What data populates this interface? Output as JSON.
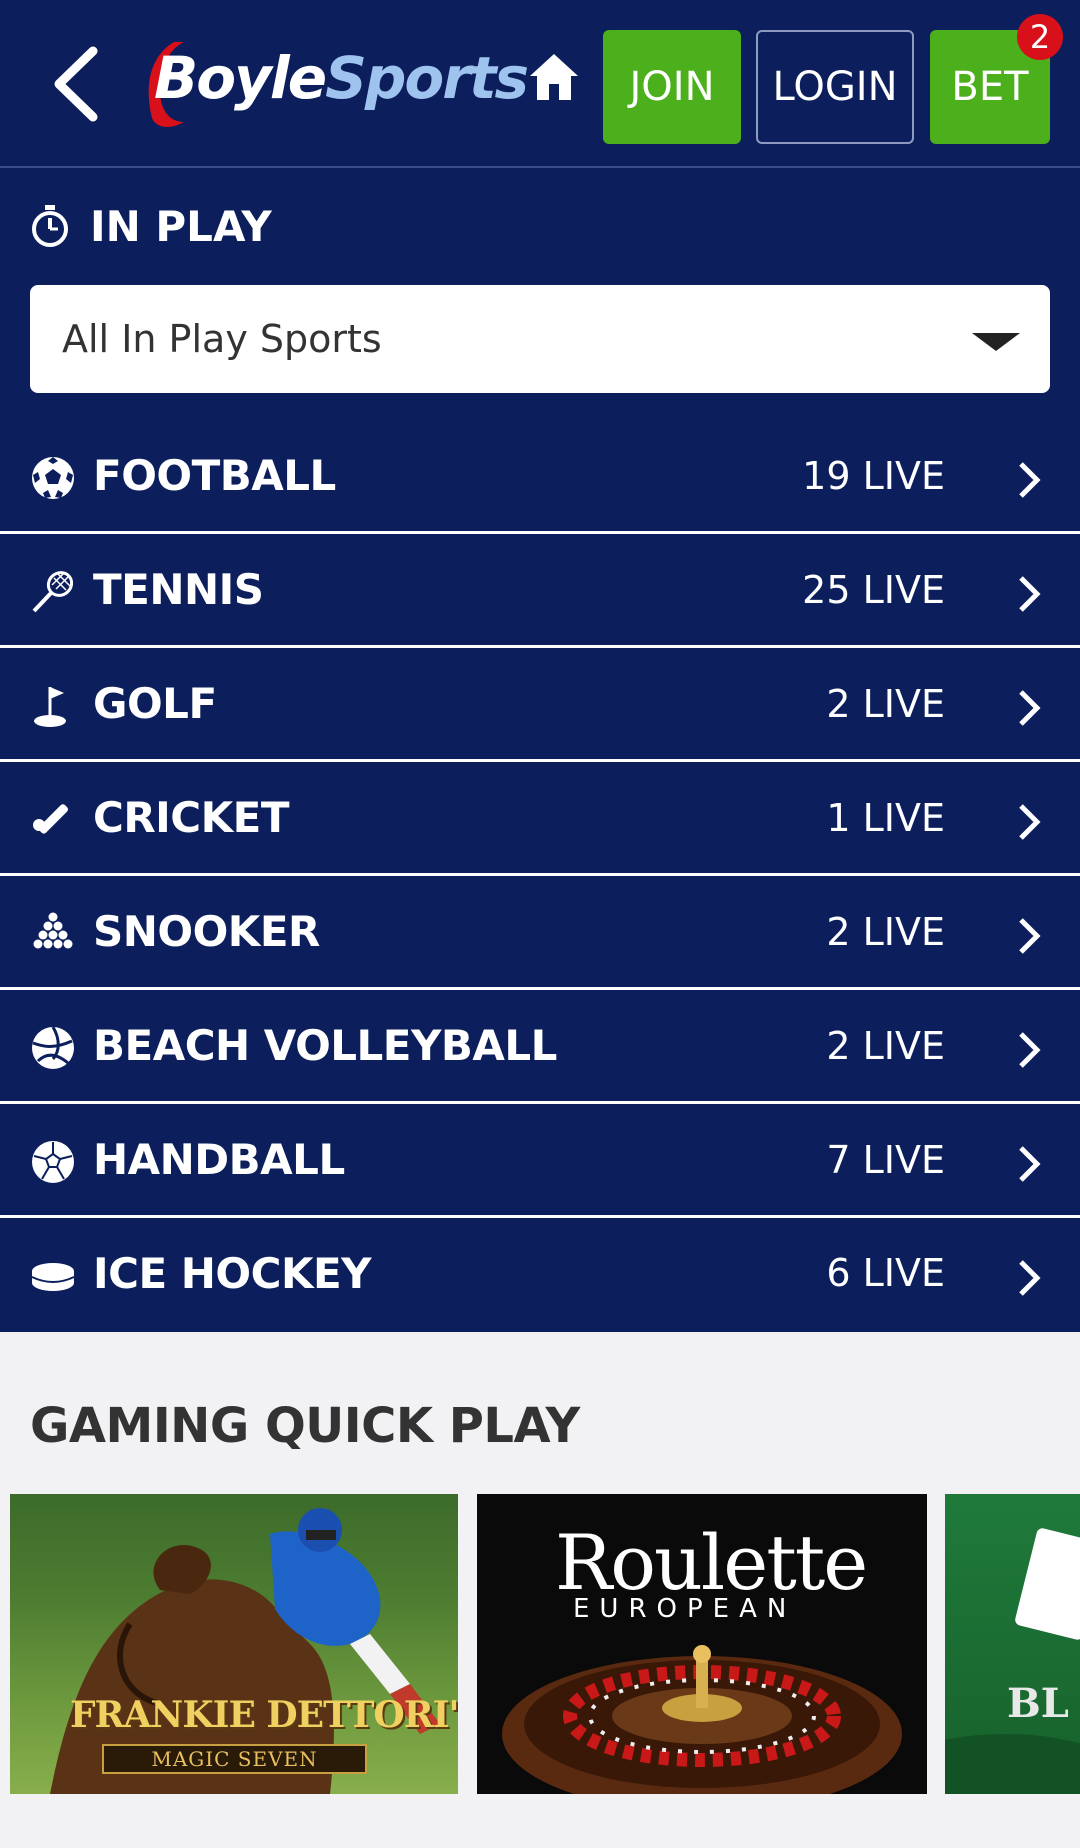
{
  "header": {
    "logo_boyle": "Boyle",
    "logo_sports": "Sports",
    "join_label": "JOIN",
    "login_label": "LOGIN",
    "bet_label": "BET",
    "bet_badge": "2"
  },
  "in_play": {
    "title": "IN PLAY",
    "filter_value": "All In Play Sports"
  },
  "sports": [
    {
      "name": "FOOTBALL",
      "count": "19 LIVE",
      "icon": "football-icon"
    },
    {
      "name": "TENNIS",
      "count": "25 LIVE",
      "icon": "tennis-racket-icon"
    },
    {
      "name": "GOLF",
      "count": "2 LIVE",
      "icon": "golf-flag-icon"
    },
    {
      "name": "CRICKET",
      "count": "1 LIVE",
      "icon": "cricket-bat-icon"
    },
    {
      "name": "SNOOKER",
      "count": "2 LIVE",
      "icon": "snooker-balls-icon"
    },
    {
      "name": "BEACH VOLLEYBALL",
      "count": "2 LIVE",
      "icon": "volleyball-icon"
    },
    {
      "name": "HANDBALL",
      "count": "7 LIVE",
      "icon": "handball-icon"
    },
    {
      "name": "ICE HOCKEY",
      "count": "6 LIVE",
      "icon": "hockey-puck-icon"
    }
  ],
  "gaming": {
    "title": "GAMING QUICK PLAY",
    "tiles": [
      {
        "title": "FRANKIE DETTORI'S",
        "subtitle": "MAGIC SEVEN"
      },
      {
        "title": "Roulette",
        "subtitle": "EUROPEAN"
      },
      {
        "title": "BL"
      }
    ]
  },
  "colors": {
    "navy": "#0c1f5c",
    "green": "#4caf1c",
    "badge_red": "#d8101a"
  }
}
